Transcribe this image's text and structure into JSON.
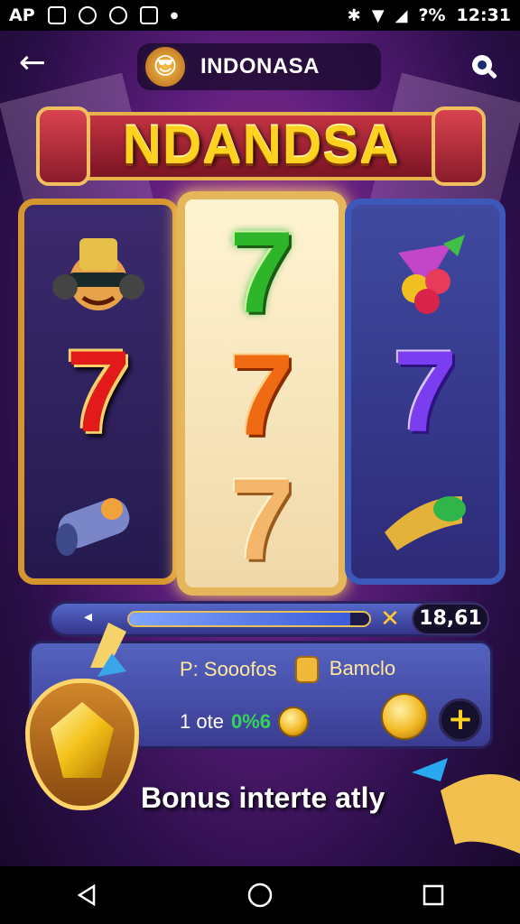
{
  "status_bar": {
    "carrier": "AP",
    "battery": "?%",
    "time": "12:31"
  },
  "header": {
    "title": "INDONASA"
  },
  "banner": {
    "title": "NDANDSA"
  },
  "reels": {
    "left": [
      "dj-character",
      "7",
      "rocket-item"
    ],
    "center": [
      "7",
      "7",
      "7"
    ],
    "right": [
      "fruit-cluster",
      "7",
      "horn-item"
    ]
  },
  "progress": {
    "fill_percent": 92,
    "counter": "18,61"
  },
  "panel": {
    "label_left": "P: Sooofos",
    "label_right": "Bamclo",
    "rate_text": "1 ote",
    "rate_pct": "0%6"
  },
  "footer": {
    "text": "Bonus interte atly"
  },
  "colors": {
    "accent": "#ffd21f",
    "reel_left": "#d5952f",
    "reel_right": "#3c58b8"
  }
}
